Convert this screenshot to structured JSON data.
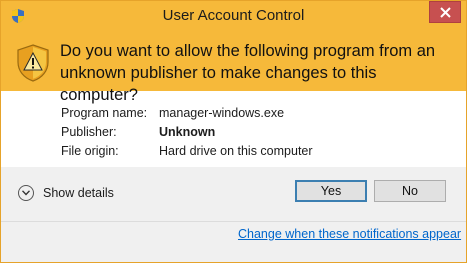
{
  "window": {
    "title": "User Account Control",
    "icon": "uac-shield-icon",
    "close_icon": "close-icon",
    "colors": {
      "banner": "#f6b93a",
      "close": "#c75050",
      "link": "#0066cc",
      "footer": "#f0f0f0"
    }
  },
  "banner": {
    "icon": "warning-shield-icon",
    "question": "Do you want to allow the following program from an unknown publisher to make changes to this computer?"
  },
  "details": {
    "rows": [
      {
        "label": "Program name:",
        "value": "manager-windows.exe"
      },
      {
        "label": "Publisher:",
        "value": "Unknown"
      },
      {
        "label": "File origin:",
        "value": "Hard drive on this computer"
      }
    ]
  },
  "footer": {
    "show_details": "Show details",
    "show_details_icon": "chevron-down-circle-icon",
    "yes_label": "Yes",
    "no_label": "No",
    "settings_link": "Change when these notifications appear"
  }
}
